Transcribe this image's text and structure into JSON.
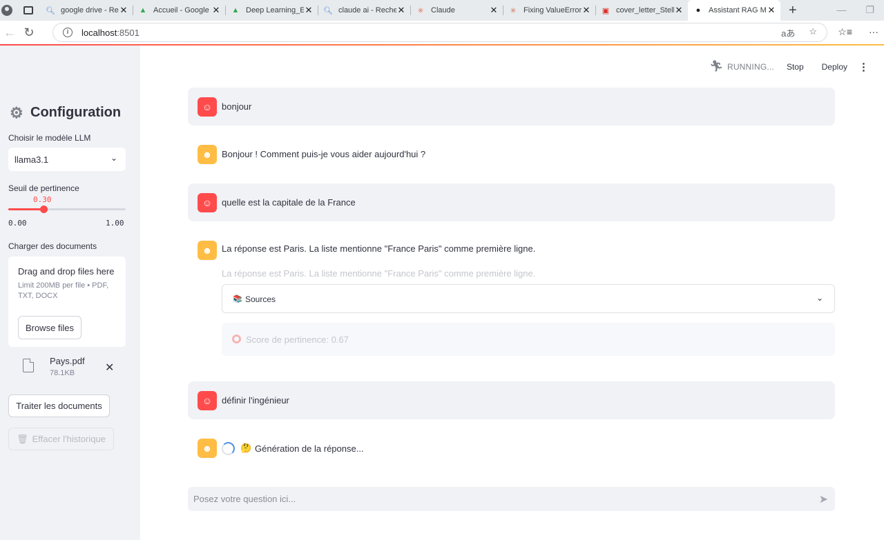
{
  "browser": {
    "tabs": [
      {
        "title": "google drive - Re",
        "icon": "search-icon"
      },
      {
        "title": "Accueil - Google",
        "icon": "drive-icon"
      },
      {
        "title": "Deep Learning_E",
        "icon": "drive-icon"
      },
      {
        "title": "claude ai - Reche",
        "icon": "search-icon"
      },
      {
        "title": "Claude",
        "icon": "claude-icon"
      },
      {
        "title": "Fixing ValueError",
        "icon": "claude-icon"
      },
      {
        "title": "cover_letter_Stell",
        "icon": "pdf-icon"
      },
      {
        "title": "Assistant RAG M",
        "icon": "streamlit-icon"
      }
    ],
    "url_host": "localhost",
    "url_port": ":8501"
  },
  "sidebar": {
    "title": "Configuration",
    "model_label": "Choisir le modèle LLM",
    "model_value": "llama3.1",
    "threshold_label": "Seuil de pertinence",
    "threshold_value": "0.30",
    "threshold_fraction": 0.3,
    "threshold_min": "0.00",
    "threshold_max": "1.00",
    "upload_label": "Charger des documents",
    "dropzone_title": "Drag and drop files here",
    "dropzone_limit": "Limit 200MB per file • PDF, TXT, DOCX",
    "browse_label": "Browse files",
    "file_name": "Pays.pdf",
    "file_size": "78.1KB",
    "process_label": "Traiter les documents",
    "clear_label": "Effacer l'historique"
  },
  "header": {
    "status": "RUNNING...",
    "stop": "Stop",
    "deploy": "Deploy"
  },
  "messages": [
    {
      "role": "user",
      "text": "bonjour"
    },
    {
      "role": "assistant",
      "text": "Bonjour ! Comment puis-je vous aider aujourd'hui ?"
    },
    {
      "role": "user",
      "text": "quelle est la capitale de la France"
    },
    {
      "role": "assistant",
      "text": "La réponse est Paris. La liste mentionne \"France Paris\" comme première ligne.",
      "ghost_text": "La réponse est Paris. La liste mentionne \"France Paris\" comme première ligne.",
      "sources_label": "Sources",
      "score_text": "Score de pertinence: 0.67"
    },
    {
      "role": "user",
      "text": "définir l'ingénieur"
    },
    {
      "role": "assistant",
      "status_text": "Génération de la réponse..."
    }
  ],
  "chat_input": {
    "placeholder": "Posez votre question ici..."
  },
  "colors": {
    "accent": "#ff4b4b",
    "bot": "#ffbd45",
    "sidebar_bg": "#f0f2f6"
  }
}
